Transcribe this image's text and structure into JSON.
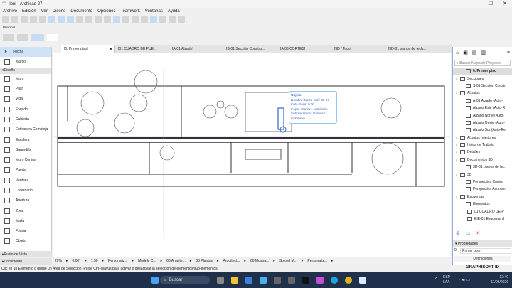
{
  "window": {
    "title": "iloni - Archicad 27",
    "minimize": "—",
    "maximize": "☐",
    "close": "✕"
  },
  "menu": [
    "Archivo",
    "Edición",
    "Ver",
    "Diseño",
    "Documento",
    "Opciones",
    "Teamwork",
    "Ventanas",
    "Ayuda"
  ],
  "toolbar": {
    "principal_label": "Principal"
  },
  "tabs": [
    "[0. Primer piso]",
    "[01 CUADRO DE PUE...",
    "[A-01 Alzado]",
    "[S-01 Sección Constru...",
    "[A.03 CORTES]",
    "[3D / Todo]",
    "[3D-01 planos de tech..."
  ],
  "toolbox": {
    "items": [
      {
        "label": "Flecha",
        "selected": true
      },
      {
        "label": "Marco"
      }
    ],
    "section_diseno": "Diseño",
    "diseno_items": [
      "Muro",
      "Pilar",
      "Viga",
      "Forjado",
      "Cubierta",
      "Estructura Compleja",
      "Escalera",
      "Barandilla",
      "Muro Cortina",
      "Puerta",
      "Ventana",
      "Lucernario",
      "Abertura",
      "Zona",
      "Malla",
      "Forma",
      "Objeto"
    ],
    "section_punto": "Punto de Vista",
    "section_documento": "Documento"
  },
  "tooltip": {
    "title": "Objeto",
    "lines": [
      "Nombre: Mesa Café 08 27",
      "Cota Base: 0.00",
      "Capa: Interior - Mobiliario",
      "Sobrescrituras Gráficas:",
      "mobiliario"
    ]
  },
  "navigator": {
    "search_placeholder": "Buscar Mapa de Proyecto",
    "current": "0. Primer piso",
    "tree": [
      {
        "label": "Secciones",
        "level": 0
      },
      {
        "label": "S-01 Sección Constr",
        "level": 1
      },
      {
        "label": "Alzados",
        "level": 0
      },
      {
        "label": "A-01 Alzado (Auto-",
        "level": 1
      },
      {
        "label": "Alzado Este (Auto-R",
        "level": 1
      },
      {
        "label": "Alzado Norte (Auto-",
        "level": 1
      },
      {
        "label": "Alzado Oeste (Auto-",
        "level": 1
      },
      {
        "label": "Alzado Sur (Auto-Re",
        "level": 1
      },
      {
        "label": "Alzados Interiores",
        "level": 0
      },
      {
        "label": "Hojas de Trabajo",
        "level": 0
      },
      {
        "label": "Detalles",
        "level": 0
      },
      {
        "label": "Documentos 3D",
        "level": 0
      },
      {
        "label": "3D-01 planos de tec",
        "level": 1
      },
      {
        "label": "3D",
        "level": 0
      },
      {
        "label": "Perspectiva Cónica",
        "level": 1
      },
      {
        "label": "Perspectiva Axonom",
        "level": 1
      },
      {
        "label": "Esquemas",
        "level": 0
      },
      {
        "label": "Elementos",
        "level": 1
      },
      {
        "label": "01 CUADRO DE P",
        "level": 2
      },
      {
        "label": "EIE-01 Esquema d",
        "level": 2
      }
    ],
    "properties_label": "Propiedades",
    "prop_id": "0.",
    "prop_value": "Primer piso",
    "definitions": "Definiciones",
    "graphisoft": "GRAPHISOFT ID"
  },
  "bottombar": [
    "29%",
    "0.00°",
    "1:50",
    "Personaliz...",
    "Modelo C...",
    "03 Arquite...",
    "03 Plantas",
    "Arquitect...",
    "00 Mostra...",
    "Solo el M...",
    "Personaliz..."
  ],
  "status": "Clic en un Elemento o dibuje un Área de Selección. Pulse Ctrl+Mayús para activar o desactivar la selección de elementos/sub-elementos.",
  "taskbar": {
    "search": "Buscar",
    "lang1": "ESP",
    "lang2": "LAA",
    "time": "12:40",
    "date": "11/03/2026"
  }
}
